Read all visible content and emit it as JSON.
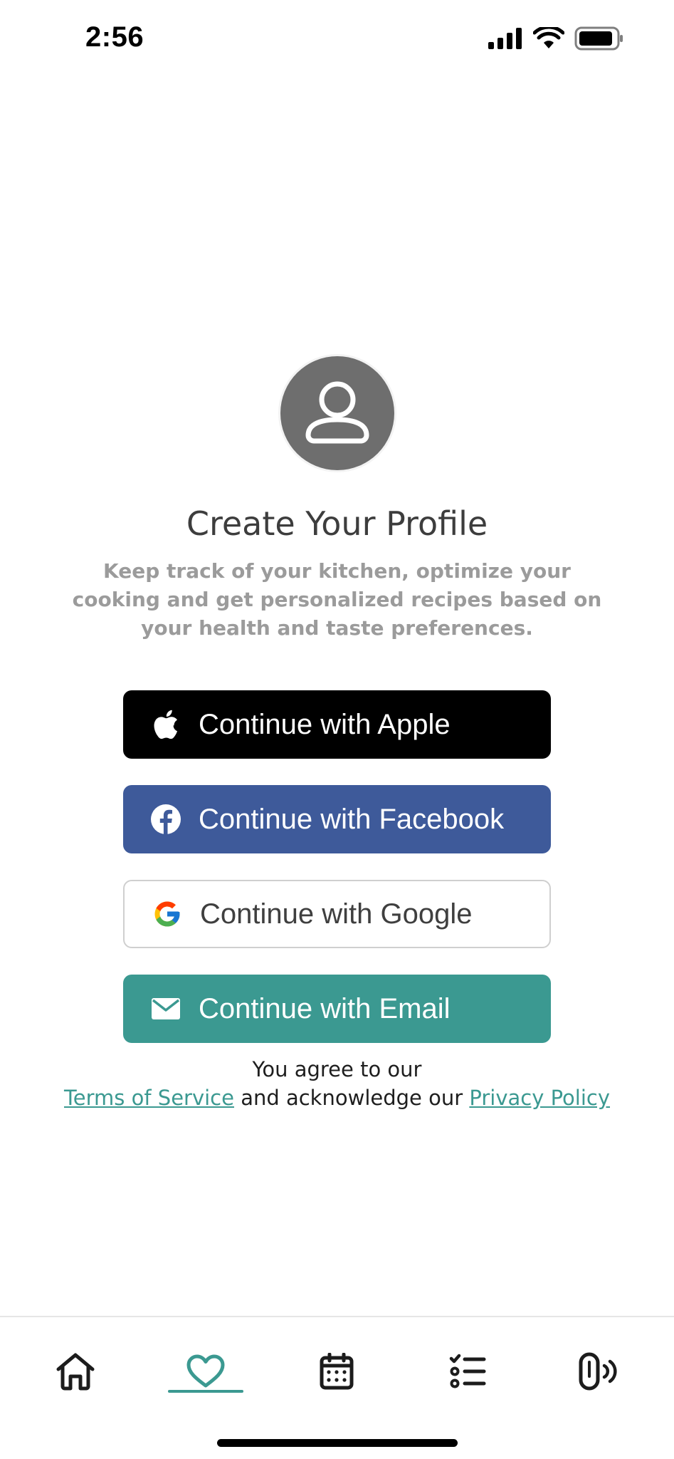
{
  "status_bar": {
    "time": "2:56"
  },
  "profile": {
    "title": "Create Your Profile",
    "subtitle": "Keep track of your kitchen, optimize your cooking and get personalized recipes based on your health and taste preferences."
  },
  "auth_buttons": {
    "apple": {
      "label": "Continue with Apple",
      "icon": "apple-icon",
      "color": "#000000"
    },
    "facebook": {
      "label": "Continue with Facebook",
      "icon": "facebook-icon",
      "color": "#3e5a9a"
    },
    "google": {
      "label": "Continue with Google",
      "icon": "google-icon",
      "color": "#ffffff"
    },
    "email": {
      "label": "Continue with Email",
      "icon": "mail-icon",
      "color": "#3b9991"
    }
  },
  "legal": {
    "line1": "You agree to our",
    "terms": "Terms of Service",
    "middle": "and acknowledge our",
    "privacy": "Privacy Policy"
  },
  "tab_bar": {
    "accent": "#3b9991",
    "tabs": [
      {
        "icon": "home-icon",
        "active": false
      },
      {
        "icon": "heart-icon",
        "active": true
      },
      {
        "icon": "calendar-icon",
        "active": false
      },
      {
        "icon": "checklist-icon",
        "active": false
      },
      {
        "icon": "device-icon",
        "active": false
      }
    ]
  }
}
